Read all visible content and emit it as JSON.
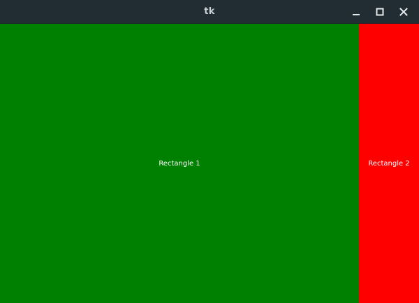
{
  "window": {
    "title": "tk",
    "controls": [
      {
        "icon": "minimize-icon"
      },
      {
        "icon": "maximize-icon"
      },
      {
        "icon": "close-icon"
      }
    ]
  },
  "canvas": {
    "rectangles": [
      {
        "label": "Rectangle 1",
        "color": "#008000"
      },
      {
        "label": "Rectangle 2",
        "color": "#ff0000"
      }
    ]
  },
  "colors": {
    "titlebar": "#222c33",
    "title_text": "#c9d1d6",
    "control_icon": "#e6ebee"
  }
}
